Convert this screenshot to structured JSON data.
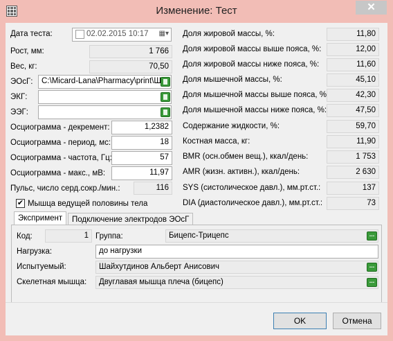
{
  "window": {
    "title": "Изменение: Тест",
    "close": "✕"
  },
  "left": {
    "date": {
      "label": "Дата теста:",
      "value": "02.02.2015 10:17"
    },
    "height": {
      "label": "Рост, мм:",
      "value": "1 766"
    },
    "weight": {
      "label": "Вес, кг:",
      "value": "70,50"
    },
    "eosg": {
      "label": "ЭОсГ:",
      "value": "C:\\Micard-Lana\\Pharmacy\\print\\Ша"
    },
    "ekg": {
      "label": "ЭКГ:",
      "value": ""
    },
    "eeg": {
      "label": "ЭЭГ:",
      "value": ""
    },
    "decrement": {
      "label": "Осциограмма - декремент:",
      "value": "1,2382"
    },
    "period": {
      "label": "Осциограмма - период, мс:",
      "value": "18"
    },
    "frequency": {
      "label": "Осциограмма - частота, Гц:",
      "value": "57"
    },
    "max": {
      "label": "Осциограмма - макс., мВ:",
      "value": "11,97"
    },
    "pulse": {
      "label": "Пульс, число серд.сокр./мин.:",
      "value": "116"
    },
    "leading_half": {
      "label": "Мышца ведущей половины тела",
      "checked": true
    }
  },
  "right": [
    {
      "label": "Доля жировой массы, %:",
      "value": "11,80"
    },
    {
      "label": "Доля жировой массы выше пояса, %:",
      "value": "12,00"
    },
    {
      "label": "Доля жировой массы ниже пояса, %:",
      "value": "11,60"
    },
    {
      "label": "Доля мышечной массы, %:",
      "value": "45,10"
    },
    {
      "label": "Доля мышечной массы выше пояса, %:",
      "value": "42,30"
    },
    {
      "label": "Доля мышечной массы ниже пояса, %:",
      "value": "47,50"
    },
    {
      "label": "Содержание жидкости, %:",
      "value": "59,70"
    },
    {
      "label": "Костная масса, кг:",
      "value": "11,90"
    },
    {
      "label": "BMR (осн.обмен вещ.), ккал/день:",
      "value": "1 753"
    },
    {
      "label": "AMR (жизн. активн.), ккал/день:",
      "value": "2 630"
    },
    {
      "label": "SYS (систолическое давл.), мм.рт.ст.:",
      "value": "137"
    },
    {
      "label": "DIA (диастолическое давл.), мм.рт.ст.:",
      "value": "73"
    }
  ],
  "tabs": [
    {
      "label": "Экспримент",
      "active": true
    },
    {
      "label": "Подключение электродов ЭОсГ",
      "active": false
    }
  ],
  "experiment": {
    "code": {
      "label": "Код:",
      "value": "1"
    },
    "group": {
      "label": "Группа:",
      "value": "Бицепс-Трицепс"
    },
    "load": {
      "label": "Нагрузка:",
      "value": "до нагрузки"
    },
    "subject": {
      "label": "Испытуемый:",
      "value": "Шайхутдинов Альберт Анисович"
    },
    "muscle": {
      "label": "Скелетная мышца:",
      "value": "Двуглавая мышца плеча (бицепс)"
    },
    "picker": "..."
  },
  "buttons": {
    "ok": "OK",
    "cancel": "Отмена"
  }
}
